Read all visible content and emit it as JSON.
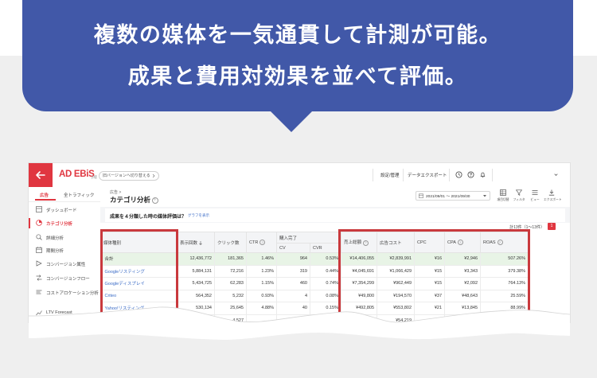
{
  "hero": {
    "line1": "複数の媒体を一気通貫して計測が可能。",
    "line2": "成果と費用対効果を並べて評価。"
  },
  "colors": {
    "bubble": "#4158a8",
    "brand_red": "#e03640",
    "highlight_red": "#c9393d",
    "link_blue": "#3a6bc6",
    "total_row": "#e8f4e6",
    "page_gray": "#efefef"
  },
  "topbar": {
    "logo": "AD EBiS",
    "logo_badge": "β版",
    "switch_version": "旧バージョンへ切り替える",
    "settings": "設定/管理",
    "data_export": "データエクスポート",
    "icons": [
      "back-arrow-icon",
      "clock-icon",
      "question-icon",
      "bell-icon",
      "chevron-down-icon"
    ]
  },
  "sidebar": {
    "tabs": [
      {
        "label": "広告",
        "active": true
      },
      {
        "label": "全トラフィック",
        "active": false
      }
    ],
    "items": [
      {
        "label": "ダッシュボード",
        "icon": "dashboard-icon"
      },
      {
        "label": "カテゴリ分析",
        "icon": "category-analysis-icon",
        "active": true
      },
      {
        "label": "詳細分析",
        "icon": "detail-analysis-icon"
      },
      {
        "label": "期間分析",
        "icon": "period-analysis-icon"
      },
      {
        "label": "コンバージョン属性",
        "icon": "conversion-attribute-icon"
      },
      {
        "label": "コンバージョンフロー",
        "icon": "conversion-flow-icon"
      },
      {
        "label": "コストアロケーション分析",
        "icon": "cost-allocation-icon"
      },
      {
        "label": "LTV Forecast",
        "icon": "ltv-forecast-icon"
      }
    ]
  },
  "main": {
    "breadcrumb": "広告 >",
    "title": "カテゴリ分析",
    "date_range": "2021/09/01 ～ 2021/09/30",
    "toolbar": [
      {
        "label": "項目切替",
        "icon": "column-switch-icon"
      },
      {
        "label": "フィルタ",
        "icon": "filter-icon"
      },
      {
        "label": "ビュー",
        "icon": "view-icon"
      },
      {
        "label": "エクスポート",
        "icon": "export-icon"
      }
    ],
    "chart_card": {
      "title": "成果を４分類した時の媒体評価は？",
      "link": "グラフを表示"
    },
    "count": "計13件（1～13件）",
    "page": "1"
  },
  "table": {
    "group_header": "購入完了",
    "headers": [
      "媒体種別",
      "表示回数",
      "クリック数",
      "CTR",
      "CV",
      "CVR",
      "売上総額",
      "広告コスト",
      "CPC",
      "CPA",
      "ROAS"
    ],
    "rows": [
      {
        "cells": [
          "合計",
          "12,436,772",
          "181,365",
          "1.46%",
          "964",
          "0.53%",
          "¥14,406,055",
          "¥2,839,991",
          "¥16",
          "¥2,946",
          "507.26%"
        ]
      },
      {
        "cells": [
          "Googleリスティング",
          "5,884,131",
          "72,216",
          "1.23%",
          "319",
          "0.44%",
          "¥4,045,691",
          "¥1,066,429",
          "¥15",
          "¥3,343",
          "379.38%"
        ]
      },
      {
        "cells": [
          "Googleディスプレイ",
          "5,434,725",
          "62,283",
          "1.15%",
          "460",
          "0.74%",
          "¥7,354,299",
          "¥962,449",
          "¥15",
          "¥2,092",
          "764.13%"
        ]
      },
      {
        "cells": [
          "Criteo",
          "564,352",
          "5,232",
          "0.93%",
          "4",
          "0.08%",
          "¥49,800",
          "¥194,570",
          "¥37",
          "¥48,643",
          "25.59%"
        ]
      },
      {
        "cells": [
          "Yahoo!リスティング",
          "530,134",
          "25,645",
          "4.88%",
          "40",
          "0.15%",
          "¥492,805",
          "¥553,802",
          "¥21",
          "¥13,845",
          "88.99%"
        ]
      },
      {
        "cells": [
          "",
          "",
          "4,527",
          "",
          "",
          "",
          "",
          "¥54,219",
          "",
          "",
          ""
        ]
      }
    ]
  }
}
